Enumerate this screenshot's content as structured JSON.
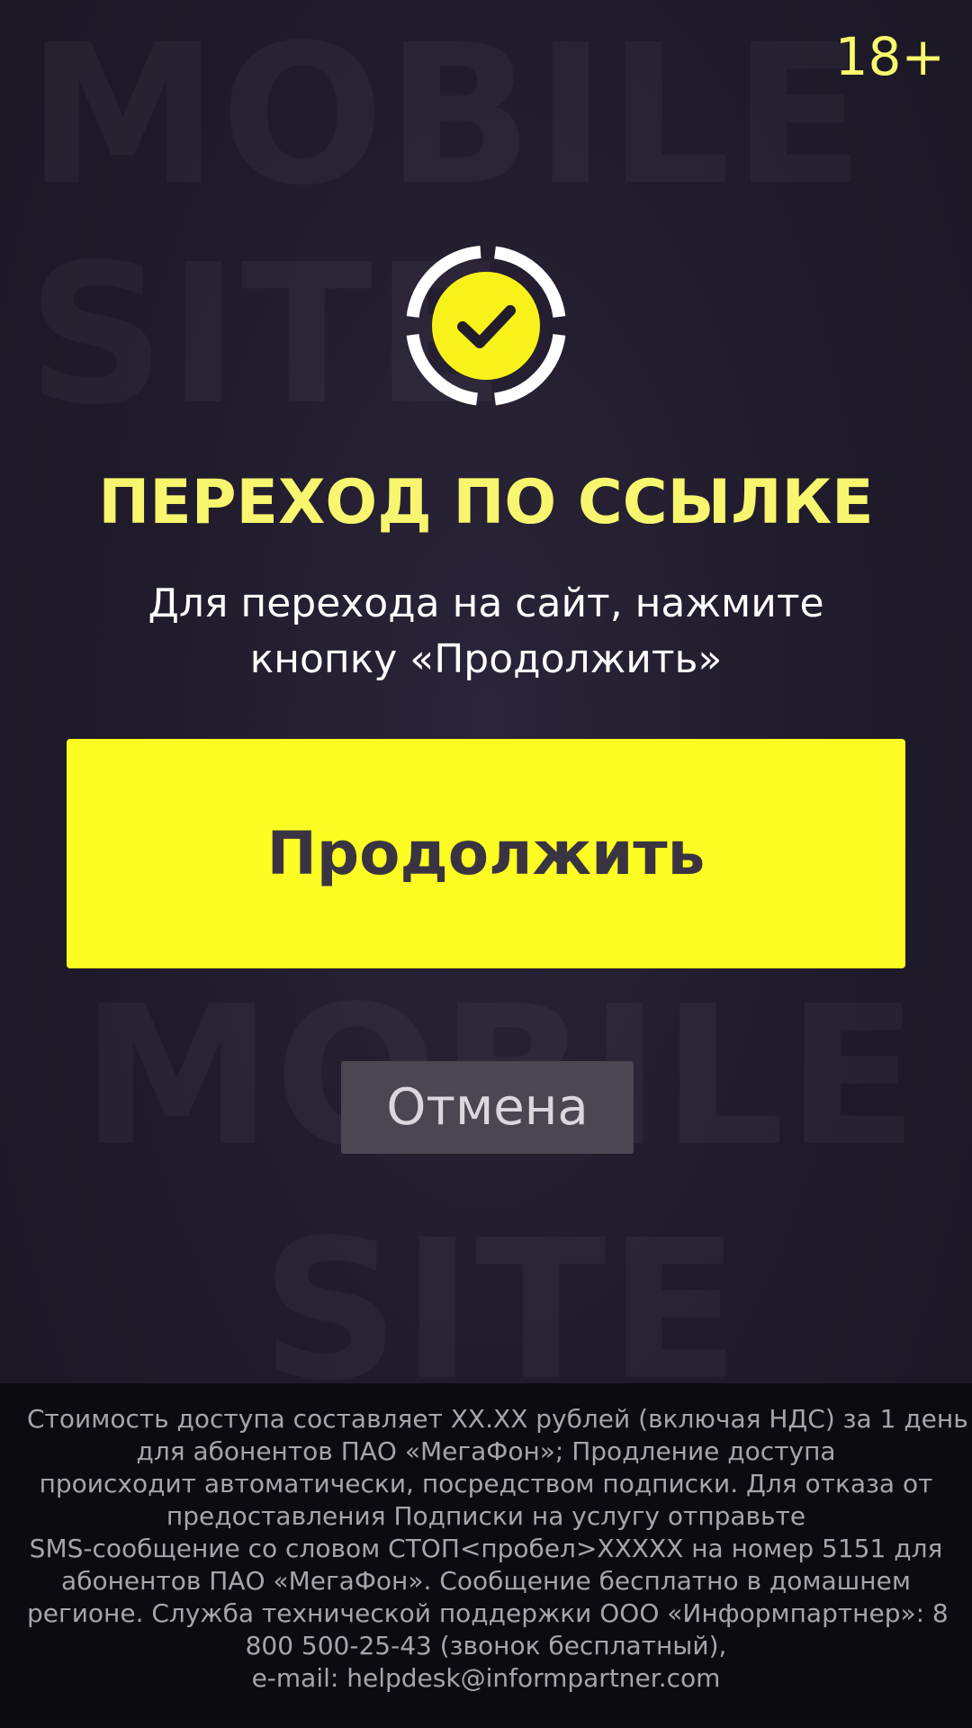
{
  "background": {
    "words": [
      "MOBILE",
      "SITE",
      "MOBILE",
      "SITE"
    ]
  },
  "age_rating": "18+",
  "logo": {
    "icon": "checkmark-badge-icon",
    "accent": "#f9f21a",
    "ring": "#ffffff",
    "check": "#221d2b"
  },
  "title": "ПЕРЕХОД ПО ССЫЛКЕ",
  "subtitle": {
    "line1": "Для перехода на сайт, нажмите",
    "line2": "кнопку «Продолжить»"
  },
  "buttons": {
    "continue_label": "Продолжить",
    "cancel_label": "Отмена"
  },
  "colors": {
    "accent_yellow": "#fdfd23",
    "title_yellow": "#f8f56e",
    "background": "#221d2c",
    "footer_bg": "#0c0b10"
  },
  "footer": {
    "lines": [
      "Стоимость доступа составляет XX.XX рублей (включая НДС) за 1 день",
      "для абонентов ПАО «МегаФон»; Продление доступа",
      "происходит автоматически, посредством подписки. Для отказа от",
      "предоставления Подписки на услугу отправьте",
      "SMS-сообщение со словом СТОП<пробел>XXXXX на номер 5151 для",
      "абонентов ПАО «МегаФон». Сообщение бесплатно в домашнем",
      "регионе. Служба технической поддержки ООО «Информпартнер»: 8",
      "800 500-25-43 (звонок бесплатный),",
      "e-mail: helpdesk@informpartner.com"
    ]
  }
}
